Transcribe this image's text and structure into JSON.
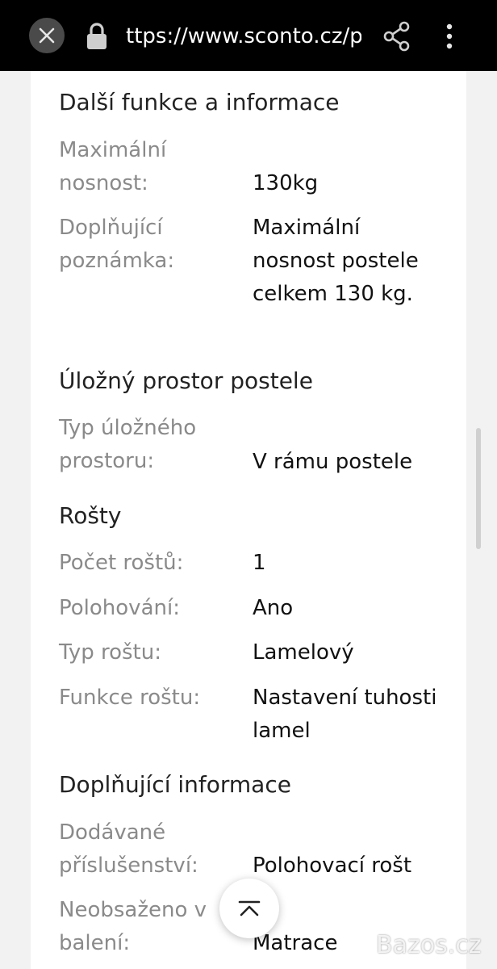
{
  "browser": {
    "url": "ttps://www.sconto.cz/p",
    "icons": [
      "close-icon",
      "lock-icon",
      "share-icon",
      "more-vert-icon"
    ]
  },
  "sections": [
    {
      "title": "Další funkce a informace",
      "rows": [
        {
          "label": "Maximální nosnost:",
          "value": "130kg"
        },
        {
          "label": "Doplňující poznámka:",
          "value": "Maximální nosnost postele celkem 130 kg."
        }
      ]
    },
    {
      "title": "Úložný prostor postele",
      "rows": [
        {
          "label": "Typ úložného prostoru:",
          "value": "V rámu postele"
        }
      ]
    },
    {
      "title": "Rošty",
      "rows": [
        {
          "label": "Počet roštů:",
          "value": "1"
        },
        {
          "label": "Polohování:",
          "value": "Ano"
        },
        {
          "label": "Typ roštu:",
          "value": "Lamelový"
        },
        {
          "label": "Funkce roštu:",
          "value": "Nastavení tuhosti lamel"
        }
      ]
    },
    {
      "title": "Doplňující informace",
      "rows": [
        {
          "label": "Dodávané příslušenství:",
          "value": "Polohovací rošt"
        },
        {
          "label": "Neobsaženo v balení:",
          "value": "Matrace"
        }
      ]
    }
  ],
  "scroll_to_top_icon": "chevron-up-icon",
  "watermark": {
    "text": "Bazos.cz"
  }
}
